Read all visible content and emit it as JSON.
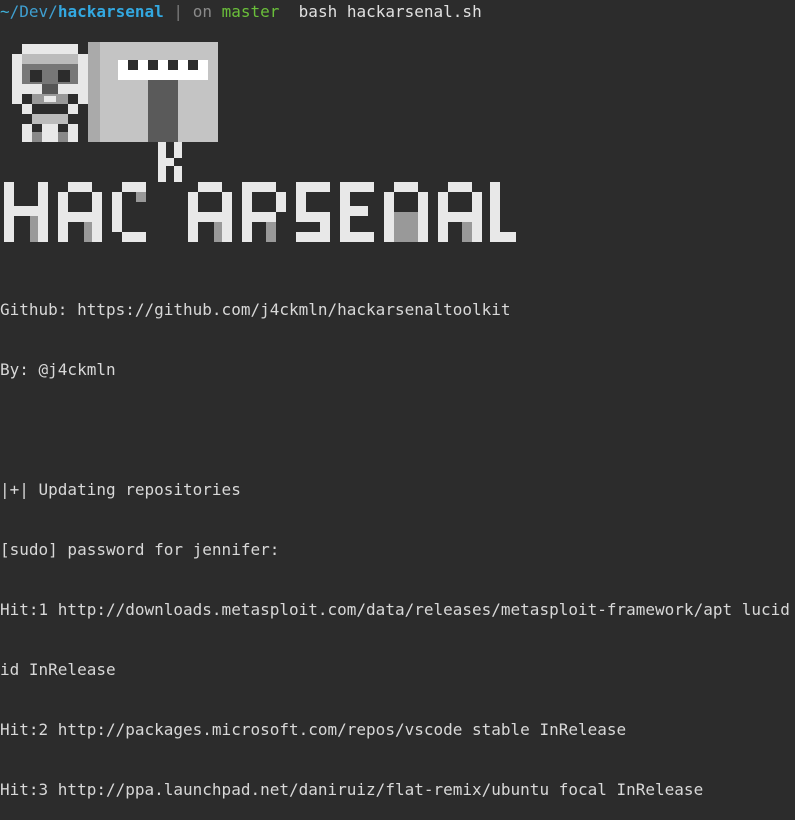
{
  "prompt": {
    "tilde": "~",
    "path_rest": "/Dev/",
    "dir": "hackarsenal",
    "separator": "|",
    "on_word": "on",
    "branch": "master",
    "command": "bash hackarsenal.sh"
  },
  "output_lines": [
    "Github: https://github.com/j4ckmln/hackarsenaltoolkit",
    "By: @j4ckmln",
    "",
    "|+| Updating repositories",
    "[sudo] password for jennifer:",
    "Hit:1 http://downloads.metasploit.com/data/releases/metasploit-framework/apt lucid InRelease",
    "id InRelease",
    "Hit:2 http://packages.microsoft.com/repos/vscode stable InRelease",
    "Hit:3 http://ppa.launchpad.net/daniruiz/flat-remix/ubuntu focal InRelease"
  ],
  "logo": {
    "banner_text": "HAC K ARSENAL"
  },
  "colors": {
    "background": "#2c2c2c",
    "text": "#d8d8d8",
    "path": "#33a8e0",
    "branch": "#6abf3a"
  }
}
